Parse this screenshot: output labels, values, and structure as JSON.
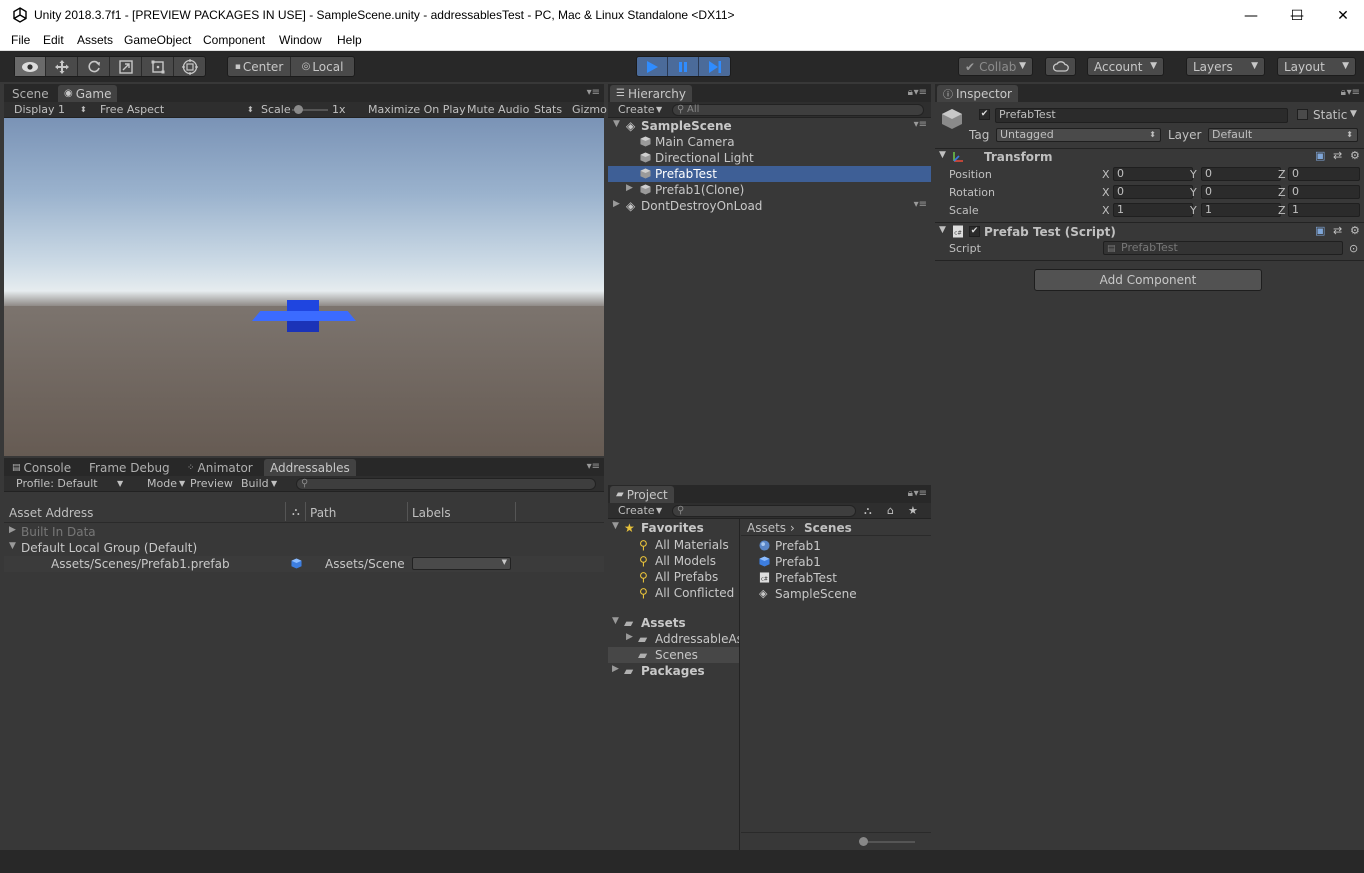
{
  "window": {
    "title": "Unity 2018.3.7f1 - [PREVIEW PACKAGES IN USE] - SampleScene.unity - addressablesTest - PC, Mac & Linux Standalone <DX11>",
    "minimize": "—",
    "maximize": "☐",
    "close": "✕"
  },
  "menu": [
    "File",
    "Edit",
    "Assets",
    "GameObject",
    "Component",
    "Window",
    "Help"
  ],
  "toolbar": {
    "pivot": "Center",
    "space": "Local",
    "collab": "Collab",
    "account": "Account",
    "layers": "Layers",
    "layout": "Layout"
  },
  "game_panel": {
    "tabs": [
      "Scene",
      "Game"
    ],
    "display": "Display 1",
    "aspect": "Free Aspect",
    "scale_label": "Scale",
    "scale_value": "1x",
    "maximize_on_play": "Maximize On Play",
    "mute_audio": "Mute Audio",
    "stats": "Stats",
    "gizmos": "Gizmo"
  },
  "bottom_panel": {
    "tabs": [
      "Console",
      "Frame Debug",
      "Animator",
      "Addressables"
    ],
    "profile": "Profile: Default",
    "mode": "Mode",
    "preview": "Preview",
    "build": "Build",
    "columns": [
      "Asset Address",
      "Path",
      "Labels"
    ],
    "groups": [
      {
        "name": "Built In Data",
        "expanded": false,
        "dim": true
      },
      {
        "name": "Default Local Group (Default)",
        "expanded": true,
        "dim": false
      }
    ],
    "entries": [
      {
        "address": "Assets/Scenes/Prefab1.prefab",
        "path": "Assets/Scenes"
      }
    ]
  },
  "hierarchy": {
    "tab": "Hierarchy",
    "create": "Create",
    "search_placeholder": "All",
    "scene": "SampleScene",
    "items": [
      "Main Camera",
      "Directional Light",
      "PrefabTest",
      "Prefab1(Clone)"
    ],
    "selected_index": 2,
    "dont_destroy": "DontDestroyOnLoad"
  },
  "project": {
    "tab": "Project",
    "create": "Create",
    "favorites_label": "Favorites",
    "favorites": [
      "All Materials",
      "All Models",
      "All Prefabs",
      "All Conflicted"
    ],
    "assets_label": "Assets",
    "assets_children": [
      "AddressableAs",
      "Scenes"
    ],
    "packages_label": "Packages",
    "breadcrumb": [
      "Assets",
      "Scenes"
    ],
    "files": [
      "Prefab1",
      "Prefab1",
      "PrefabTest",
      "SampleScene"
    ]
  },
  "inspector": {
    "tab": "Inspector",
    "object_name": "PrefabTest",
    "static_label": "Static",
    "tag_label": "Tag",
    "tag_value": "Untagged",
    "layer_label": "Layer",
    "layer_value": "Default",
    "transform": {
      "title": "Transform",
      "rows": [
        {
          "label": "Position",
          "x": "0",
          "y": "0",
          "z": "0"
        },
        {
          "label": "Rotation",
          "x": "0",
          "y": "0",
          "z": "0"
        },
        {
          "label": "Scale",
          "x": "1",
          "y": "1",
          "z": "1"
        }
      ]
    },
    "script": {
      "title": "Prefab Test (Script)",
      "label": "Script",
      "value": "PrefabTest"
    },
    "add_component": "Add Component"
  },
  "axis_labels": {
    "x": "X",
    "y": "Y",
    "z": "Z"
  }
}
